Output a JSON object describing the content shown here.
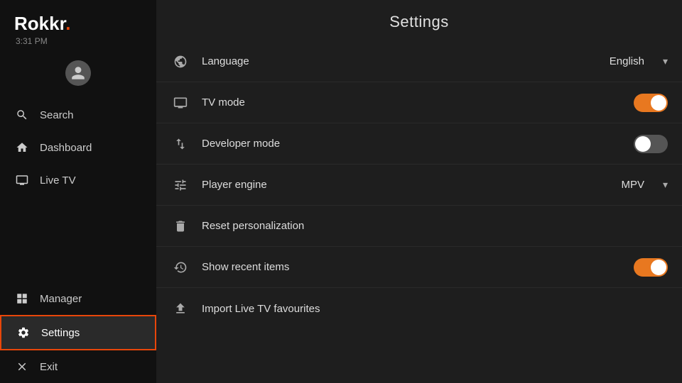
{
  "sidebar": {
    "logo": "Rokkr",
    "logo_dot": ".",
    "time": "3:31 PM",
    "items": [
      {
        "id": "search",
        "label": "Search",
        "icon": "search"
      },
      {
        "id": "dashboard",
        "label": "Dashboard",
        "icon": "home"
      },
      {
        "id": "livetv",
        "label": "Live TV",
        "icon": "tv"
      },
      {
        "id": "manager",
        "label": "Manager",
        "icon": "grid"
      },
      {
        "id": "settings",
        "label": "Settings",
        "icon": "gear",
        "active": true
      },
      {
        "id": "exit",
        "label": "Exit",
        "icon": "x"
      }
    ]
  },
  "main": {
    "title": "Settings",
    "settings": [
      {
        "id": "language",
        "label": "Language",
        "icon": "globe",
        "type": "dropdown",
        "value": "English"
      },
      {
        "id": "tvmode",
        "label": "TV mode",
        "icon": "monitor",
        "type": "toggle",
        "value": true
      },
      {
        "id": "devmode",
        "label": "Developer mode",
        "icon": "swap",
        "type": "toggle",
        "value": false
      },
      {
        "id": "playerengine",
        "label": "Player engine",
        "icon": "sliders",
        "type": "dropdown",
        "value": "MPV"
      },
      {
        "id": "resetpersonalization",
        "label": "Reset personalization",
        "icon": "trash",
        "type": "action",
        "value": null
      },
      {
        "id": "showrecent",
        "label": "Show recent items",
        "icon": "history",
        "type": "toggle",
        "value": true
      },
      {
        "id": "importlivetv",
        "label": "Import Live TV favourites",
        "icon": "upload",
        "type": "action",
        "value": null
      }
    ]
  }
}
